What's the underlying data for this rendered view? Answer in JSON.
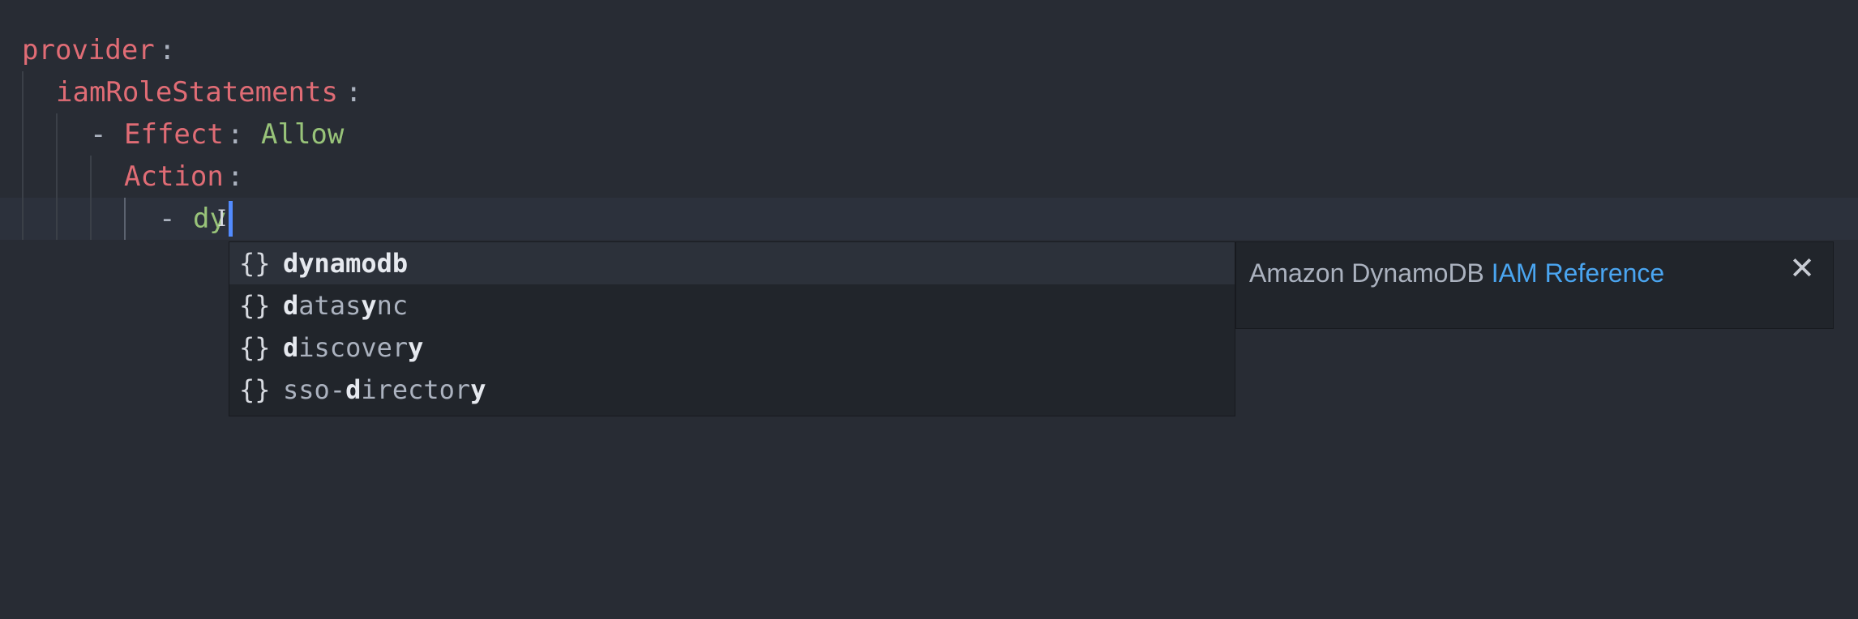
{
  "editor": {
    "lines": [
      {
        "key": "provider",
        "colon": ":"
      },
      {
        "key": "iamRoleStatements",
        "colon": ":"
      },
      {
        "dash": "-",
        "key": "Effect",
        "colon": ":",
        "value": "Allow"
      },
      {
        "key": "Action",
        "colon": ":"
      },
      {
        "dash": "-",
        "value": "dy"
      }
    ],
    "colors": {
      "key": "#e06c75",
      "string": "#98c379",
      "cursor": "#528bff"
    }
  },
  "suggest": {
    "items": [
      {
        "icon": "{}",
        "parts": [
          {
            "t": "dynamodb",
            "b": true
          }
        ]
      },
      {
        "icon": "{}",
        "parts": [
          {
            "t": "d",
            "b": true
          },
          {
            "t": "atas",
            "b": false
          },
          {
            "t": "y",
            "b": true
          },
          {
            "t": "nc",
            "b": false
          }
        ]
      },
      {
        "icon": "{}",
        "parts": [
          {
            "t": "d",
            "b": true
          },
          {
            "t": "iscover",
            "b": false
          },
          {
            "t": "y",
            "b": true
          }
        ]
      },
      {
        "icon": "{}",
        "parts": [
          {
            "t": "sso-",
            "b": false
          },
          {
            "t": "d",
            "b": true
          },
          {
            "t": "irector",
            "b": false
          },
          {
            "t": "y",
            "b": true
          }
        ]
      }
    ],
    "selected_index": 0
  },
  "details": {
    "text": "Amazon DynamoDB ",
    "link": "IAM Reference",
    "close_icon": "close-icon"
  }
}
